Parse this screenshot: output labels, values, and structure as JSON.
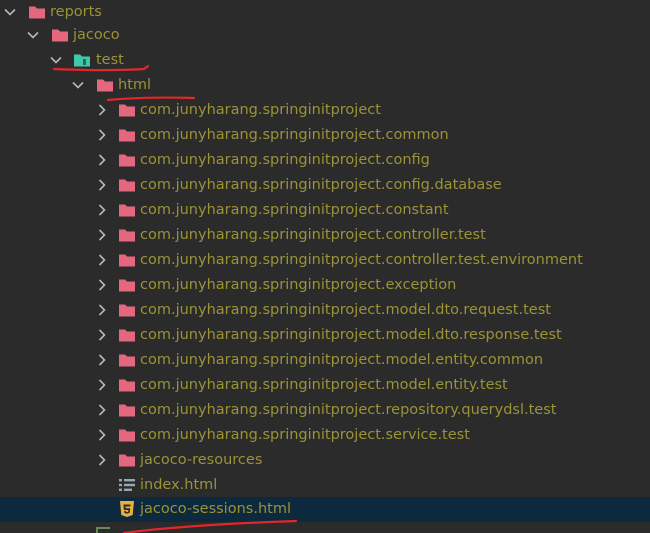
{
  "tree": {
    "items": [
      {
        "label": "reports",
        "icon": "folder-icon"
      },
      {
        "label": "jacoco",
        "icon": "folder-icon"
      },
      {
        "label": "test",
        "icon": "test-folder-icon"
      },
      {
        "label": "html",
        "icon": "folder-icon"
      },
      {
        "label": "com.junyharang.springinitproject",
        "icon": "folder-icon"
      },
      {
        "label": "com.junyharang.springinitproject.common",
        "icon": "folder-icon"
      },
      {
        "label": "com.junyharang.springinitproject.config",
        "icon": "folder-icon"
      },
      {
        "label": "com.junyharang.springinitproject.config.database",
        "icon": "folder-icon"
      },
      {
        "label": "com.junyharang.springinitproject.constant",
        "icon": "folder-icon"
      },
      {
        "label": "com.junyharang.springinitproject.controller.test",
        "icon": "folder-icon"
      },
      {
        "label": "com.junyharang.springinitproject.controller.test.environment",
        "icon": "folder-icon"
      },
      {
        "label": "com.junyharang.springinitproject.exception",
        "icon": "folder-icon"
      },
      {
        "label": "com.junyharang.springinitproject.model.dto.request.test",
        "icon": "folder-icon"
      },
      {
        "label": "com.junyharang.springinitproject.model.dto.response.test",
        "icon": "folder-icon"
      },
      {
        "label": "com.junyharang.springinitproject.model.entity.common",
        "icon": "folder-icon"
      },
      {
        "label": "com.junyharang.springinitproject.model.entity.test",
        "icon": "folder-icon"
      },
      {
        "label": "com.junyharang.springinitproject.repository.querydsl.test",
        "icon": "folder-icon"
      },
      {
        "label": "com.junyharang.springinitproject.service.test",
        "icon": "folder-icon"
      },
      {
        "label": "jacoco-resources",
        "icon": "folder-icon"
      },
      {
        "label": "index.html",
        "icon": "list-file-icon"
      },
      {
        "label": "jacoco-sessions.html",
        "icon": "html5-file-icon"
      }
    ]
  },
  "colors": {
    "background": "#2b2b2b",
    "label": "#9b9335",
    "folder": "#e5677d",
    "test_folder": "#3fc8aa",
    "selection": "#0d293e",
    "annotation": "#e0282a"
  }
}
